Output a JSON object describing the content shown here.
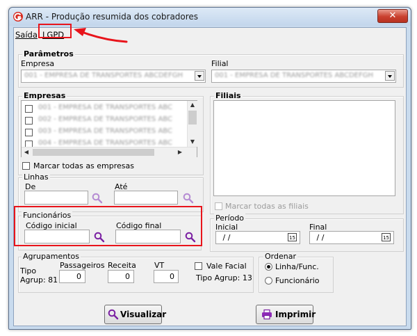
{
  "window": {
    "title": "ARR - Produção resumida dos cobradores",
    "close_glyph": "✕"
  },
  "menu": {
    "items": [
      {
        "label": "Saída"
      },
      {
        "label": "LGPD"
      }
    ]
  },
  "parametros": {
    "title": "Parâmetros",
    "empresa_label": "Empresa",
    "filial_label": "Filial",
    "empresa_value": "001 - EMPRESA DE TRANSPORTES ABCDEFGH",
    "filial_value": "001 - EMPRESA DE TRANSPORTES ABCDEFGH"
  },
  "empresas": {
    "title": "Empresas",
    "items": [
      "001 - EMPRESA DE TRANSPORTES ABC",
      "002 - EMPRESA DE TRANSPORTES ABC",
      "003 - EMPRESA DE TRANSPORTES ABC",
      "004 - EMPRESA DE TRANSPORTES ABC"
    ],
    "select_all_label": "Marcar todas as empresas"
  },
  "filiais": {
    "title": "Filiais",
    "select_all_label": "Marcar todas as filiais"
  },
  "linhas": {
    "title": "Linhas",
    "de_label": "De",
    "ate_label": "Até",
    "de_value": "",
    "ate_value": ""
  },
  "funcionarios": {
    "title": "Funcionários",
    "codigo_inicial_label": "Código inicial",
    "codigo_final_label": "Código final",
    "codigo_inicial_value": "",
    "codigo_final_value": ""
  },
  "periodo": {
    "title": "Período",
    "inicial_label": "Inicial",
    "final_label": "Final",
    "inicial_value": " / /",
    "final_value": " / /",
    "calendar_glyph": "15"
  },
  "agrupamentos": {
    "title": "Agrupamentos",
    "tipo_label": "Tipo",
    "tipo_agrup_label": "Agrup: 81",
    "passageiros_label": "Passageiros",
    "receita_label": "Receita",
    "vt_label": "VT",
    "passageiros_value": "0",
    "receita_value": "0",
    "vt_value": "0",
    "vale_facial_label": "Vale Facial",
    "tipo_agrup_13_label": "Tipo Agrup: 13"
  },
  "ordenar": {
    "title": "Ordenar",
    "options": [
      "Linha/Func.",
      "Funcionário"
    ],
    "selected": "Linha/Func."
  },
  "buttons": {
    "visualizar": "Visualizar",
    "imprimir": "Imprimir"
  },
  "colors": {
    "highlight_red": "#e8141b",
    "title_bar": "#c9dbee",
    "magnifier": "#7a1fa2"
  }
}
